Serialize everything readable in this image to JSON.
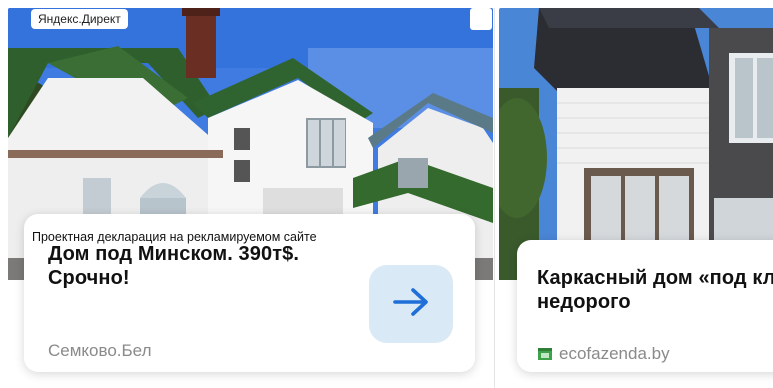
{
  "ad_network_label": "Яндекс.Директ",
  "colors": {
    "accent": "#1f6fd8",
    "button_bg": "#d9e9f6",
    "domain_text": "#8a8a8a",
    "favicon_green": "#3ea24a"
  },
  "ads": [
    {
      "disclaimer": "Проектная декларация на рекламируемом сайте",
      "title": "Дом под Минском. 390т$. Срочно!",
      "domain": "Семково.Бел",
      "button_icon": "arrow-right-icon"
    },
    {
      "title": "Каркасный дом «под ключ» недорого",
      "domain": "ecofazenda.by",
      "favicon_icon": "ecofazenda-favicon-icon"
    }
  ]
}
